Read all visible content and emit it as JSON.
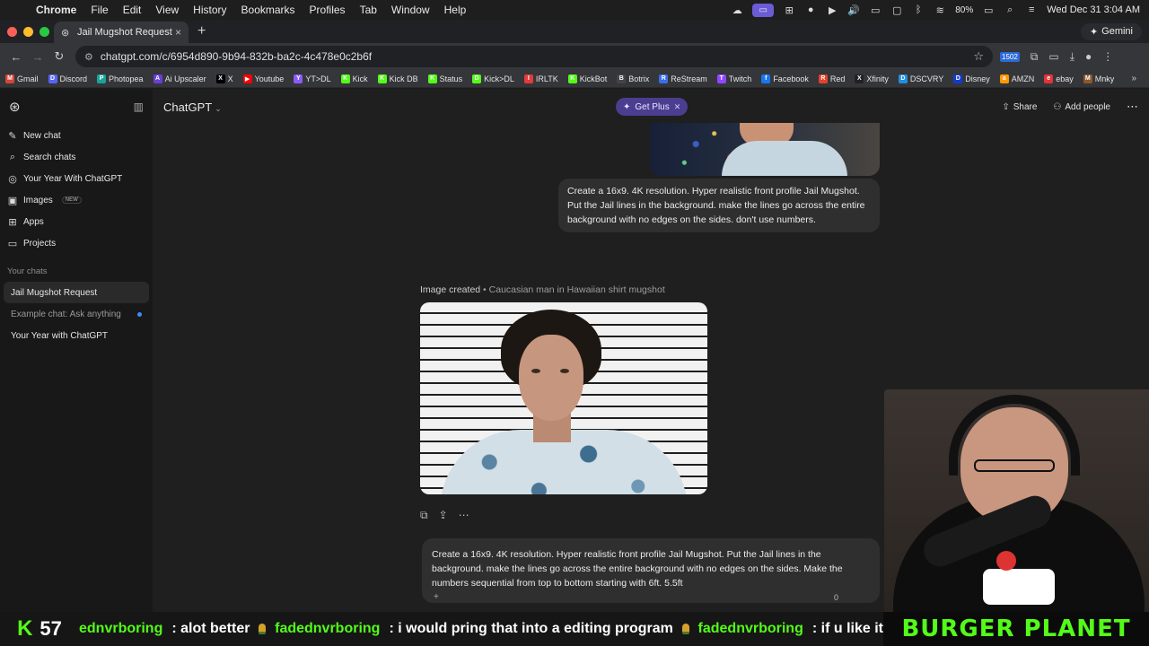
{
  "menubar": {
    "app": "Chrome",
    "items": [
      "File",
      "Edit",
      "View",
      "History",
      "Bookmarks",
      "Profiles",
      "Tab",
      "Window",
      "Help"
    ],
    "battery": "80%",
    "datetime": "Wed Dec 31  3:04 AM"
  },
  "browser": {
    "tab_title": "Jail Mugshot Request",
    "gemini_label": "Gemini",
    "url": "chatgpt.com/c/6954d890-9b94-832b-ba2c-4c478e0c2b6f",
    "ext_badge": "1502"
  },
  "bookmarks": [
    {
      "label": "Gmail",
      "color": "#d44638",
      "glyph": "M"
    },
    {
      "label": "Discord",
      "color": "#5865f2",
      "glyph": "D"
    },
    {
      "label": "Photopea",
      "color": "#18a497",
      "glyph": "P"
    },
    {
      "label": "Ai Upscaler",
      "color": "#6a3fd6",
      "glyph": "A"
    },
    {
      "label": "X",
      "color": "#000000",
      "glyph": "X"
    },
    {
      "label": "Youtube",
      "color": "#ff0000",
      "glyph": "▶"
    },
    {
      "label": "YT>DL",
      "color": "#8a5cf6",
      "glyph": "Y"
    },
    {
      "label": "Kick",
      "color": "#53fc18",
      "glyph": "K"
    },
    {
      "label": "Kick DB",
      "color": "#53fc18",
      "glyph": "K"
    },
    {
      "label": "Status",
      "color": "#53fc18",
      "glyph": "K"
    },
    {
      "label": "Kick>DL",
      "color": "#53fc18",
      "glyph": "D"
    },
    {
      "label": "IRLTK",
      "color": "#e23b3b",
      "glyph": "I"
    },
    {
      "label": "KickBot",
      "color": "#53fc18",
      "glyph": "K"
    },
    {
      "label": "Botrix",
      "color": "#444444",
      "glyph": "B"
    },
    {
      "label": "ReStream",
      "color": "#3a6ee8",
      "glyph": "R"
    },
    {
      "label": "Twitch",
      "color": "#9146ff",
      "glyph": "T"
    },
    {
      "label": "Facebook",
      "color": "#1877f2",
      "glyph": "f"
    },
    {
      "label": "Red",
      "color": "#e2432a",
      "glyph": "R"
    },
    {
      "label": "Xfinity",
      "color": "#222222",
      "glyph": "X"
    },
    {
      "label": "DSCVRY",
      "color": "#1f8fe5",
      "glyph": "D"
    },
    {
      "label": "Disney",
      "color": "#113ccf",
      "glyph": "D"
    },
    {
      "label": "AMZN",
      "color": "#ff9900",
      "glyph": "a"
    },
    {
      "label": "ebay",
      "color": "#e53238",
      "glyph": "e"
    },
    {
      "label": "Mnky",
      "color": "#8b5a2b",
      "glyph": "M"
    }
  ],
  "sidebar": {
    "items": [
      {
        "label": "New chat",
        "icon": "✎"
      },
      {
        "label": "Search chats",
        "icon": "⌕"
      },
      {
        "label": "Your Year With ChatGPT",
        "icon": "◎"
      },
      {
        "label": "Images",
        "icon": "▣",
        "badge": "NEW"
      },
      {
        "label": "Apps",
        "icon": "⊞"
      },
      {
        "label": "Projects",
        "icon": "▭"
      }
    ],
    "section_label": "Your chats",
    "chats": [
      "Jail Mugshot Request",
      "Example chat: Ask anything",
      "Your Year with ChatGPT"
    ]
  },
  "header": {
    "model": "ChatGPT",
    "get_plus": "Get Plus",
    "share": "Share",
    "add_people": "Add people"
  },
  "conversation": {
    "message1": "Create a 16x9. 4K resolution. Hyper realistic front profile Jail Mugshot. Put the Jail lines in the background. make the lines go across the entire background with no edges on the sides. don't use numbers.",
    "image_created": "Image created",
    "image_caption": "Caucasian man in Hawaiian shirt mugshot",
    "message2": "Create a 16x9. 4K resolution. Hyper realistic front profile Jail Mugshot. Put the Jail lines in the background. make the lines go across the entire background with no edges on the sides. Make the numbers sequential from top to bottom starting with 6ft. 5.5ft"
  },
  "ticker": {
    "count": "57",
    "messages": [
      {
        "user": "",
        "text": "ednvrboring : alot better"
      },
      {
        "user": "fadednvrboring",
        "text": ": i would pring that into a editing program"
      },
      {
        "user": "fadednvrboring",
        "text": ": if u like it"
      }
    ],
    "banner": "BURGER PLANET"
  }
}
